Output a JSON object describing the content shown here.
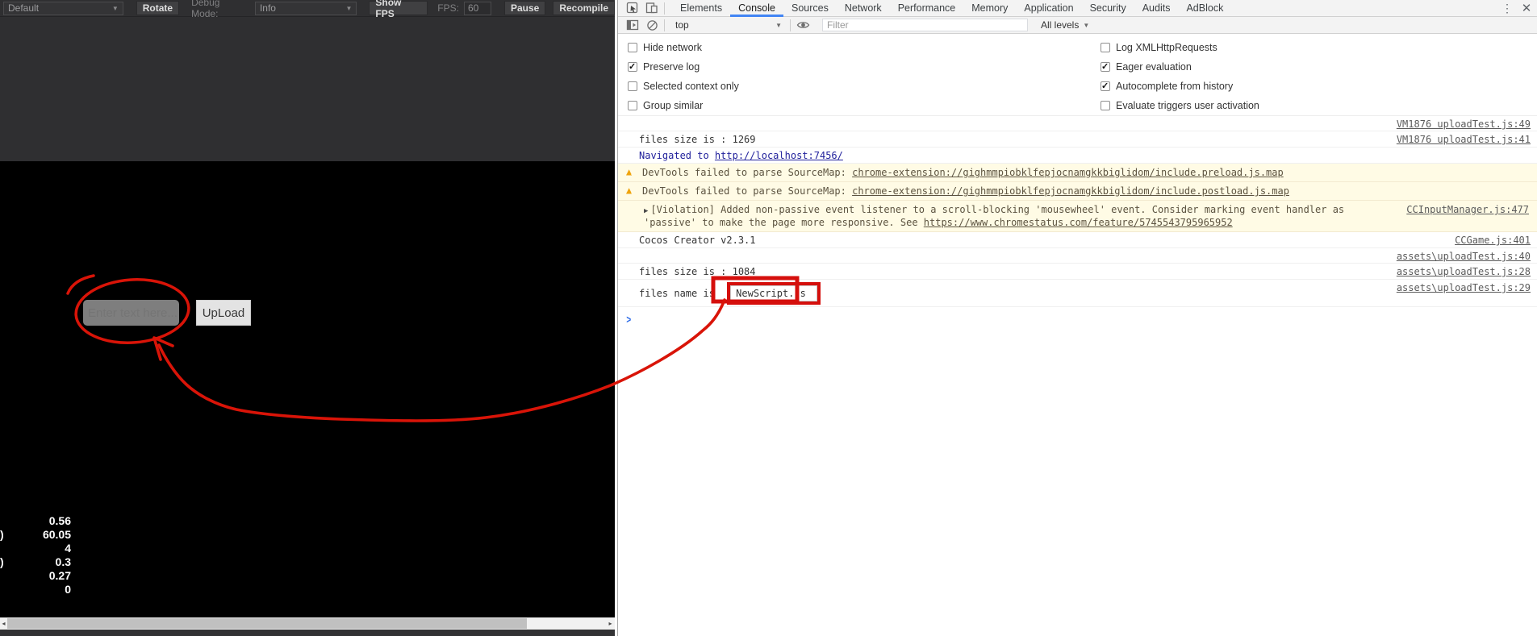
{
  "game_toolbar": {
    "scene_select": "Default",
    "rotate_button": "Rotate",
    "debug_mode_label": "Debug Mode:",
    "debug_select": "Info",
    "show_fps_button": "Show FPS",
    "fps_label": "FPS:",
    "fps_value": "60",
    "pause_button": "Pause",
    "recompile_button": "Recompile",
    "caret": "▼"
  },
  "game": {
    "input_placeholder": "Enter text here...",
    "upload_button": "UpLoad",
    "stats": [
      {
        "frag": "",
        "value": "0.56"
      },
      {
        "frag": ")",
        "value": "60.05"
      },
      {
        "frag": "",
        "value": "4"
      },
      {
        "frag": ")",
        "value": "0.3"
      },
      {
        "frag": "",
        "value": "0.27"
      },
      {
        "frag": "",
        "value": "0"
      }
    ],
    "scroll_left_arrow": "◂",
    "scroll_right_arrow": "▸"
  },
  "devtools": {
    "tabs": [
      "Elements",
      "Console",
      "Sources",
      "Network",
      "Performance",
      "Memory",
      "Application",
      "Security",
      "Audits",
      "AdBlock"
    ],
    "active_tab": "Console",
    "kebab": "⋮",
    "close": "✕",
    "frame_select": "top",
    "caret": "▼",
    "filter_placeholder": "Filter",
    "level_select": "All levels",
    "settings_left": [
      {
        "label": "Hide network",
        "checked": false
      },
      {
        "label": "Preserve log",
        "checked": true
      },
      {
        "label": "Selected context only",
        "checked": false
      },
      {
        "label": "Group similar",
        "checked": false
      }
    ],
    "settings_right": [
      {
        "label": "Log XMLHttpRequests",
        "checked": false
      },
      {
        "label": "Eager evaluation",
        "checked": true
      },
      {
        "label": "Autocomplete from history",
        "checked": true
      },
      {
        "label": "Evaluate triggers user activation",
        "checked": false
      }
    ],
    "messages": [
      {
        "kind": "log",
        "text": "",
        "source": "VM1876 uploadTest.js:49"
      },
      {
        "kind": "log",
        "text": "files size is : 1269",
        "source": "VM1876 uploadTest.js:41"
      },
      {
        "kind": "navigate",
        "text": "Navigated to ",
        "link": "http://localhost:7456/"
      },
      {
        "kind": "warning",
        "text": "DevTools failed to parse SourceMap: ",
        "link": "chrome-extension://gighmmpiobklfepjocnamgkkbiglidom/include.preload.js.map"
      },
      {
        "kind": "warning",
        "text": "DevTools failed to parse SourceMap: ",
        "link": "chrome-extension://gighmmpiobklfepjocnamgkkbiglidom/include.postload.js.map"
      },
      {
        "kind": "violation",
        "expand": "▶",
        "text": "[Violation] Added non-passive event listener to a scroll-blocking 'mousewheel' event. Consider marking event handler as 'passive' to make the page more responsive. See ",
        "link": "https://www.chromestatus.com/feature/5745543795965952",
        "source": "CCInputManager.js:477"
      },
      {
        "kind": "log",
        "text": "Cocos Creator v2.3.1",
        "source": "CCGame.js:401"
      },
      {
        "kind": "log",
        "text": "",
        "source": "assets\\uploadTest.js:40"
      },
      {
        "kind": "log",
        "text": "files size is : 1084",
        "source": "assets\\uploadTest.js:28"
      },
      {
        "kind": "log",
        "text": "files name is ",
        "boxed": "NewScript.js",
        "source": "assets\\uploadTest.js:29"
      }
    ],
    "prompt": ">",
    "warning_icon": "▲"
  },
  "colors": {
    "annotation_red": "#d91408",
    "devtools_accent_blue": "#4285f4",
    "warning_bg": "#fffbe5",
    "navigate_text": "#21219c",
    "game_pane_bg": "#2f2f31",
    "canvas_bg": "#000000"
  }
}
